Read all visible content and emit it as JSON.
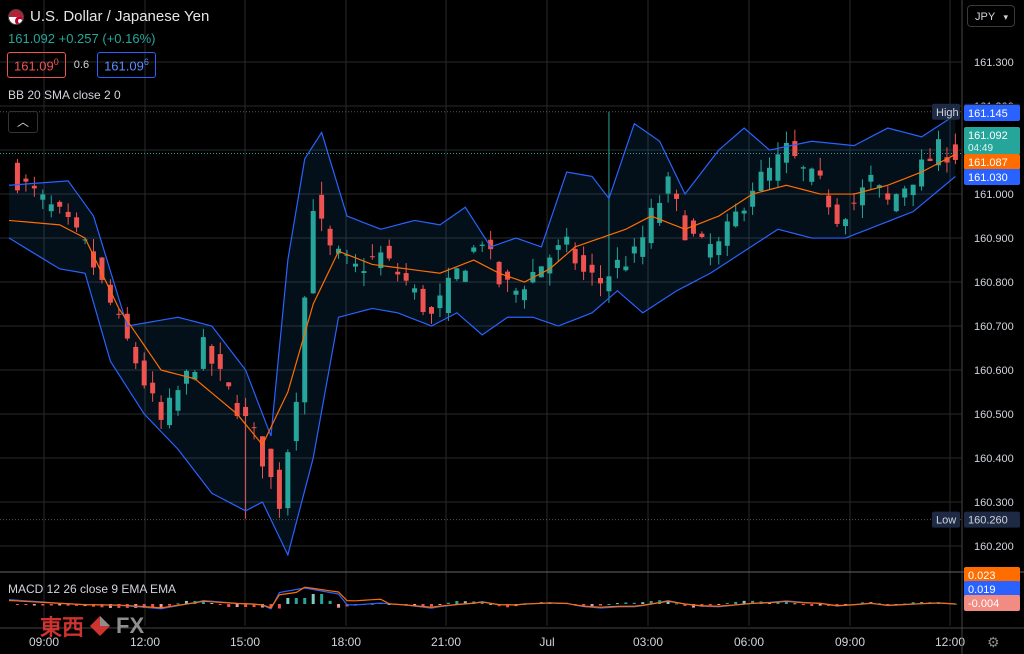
{
  "header": {
    "symbol": "U.S. Dollar / Japanese Yen",
    "last": "161.092",
    "change": "+0.257 (+0.16%)",
    "bid": "161.09",
    "bid_sup": "0",
    "spread": "0.6",
    "ask": "161.09",
    "ask_sup": "6",
    "bb_label": "BB 20 SMA close 2 0",
    "collapse_icon": "chevron-up-icon",
    "currency": "JPY"
  },
  "macd_label": "MACD 12 26 close 9 EMA EMA",
  "logo": {
    "cn": "東西",
    "fx": "FX"
  },
  "colors": {
    "up": "#26a69a",
    "down": "#ef5350",
    "bb": "#2962ff",
    "basis": "#ff6d00",
    "macd": "#2962ff",
    "signal": "#ff6d00",
    "grid": "#2a2a2a"
  },
  "chart_data": {
    "type": "candlestick",
    "title": "U.S. Dollar / Japanese Yen",
    "ylim": [
      160.163,
      161.341
    ],
    "y_ticks": [
      "161.300",
      "161.200",
      "161.100",
      "161.000",
      "160.900",
      "160.800",
      "160.700",
      "160.600",
      "160.500",
      "160.400",
      "160.300",
      "160.200"
    ],
    "x_ticks": [
      "09:00",
      "12:00",
      "15:00",
      "18:00",
      "21:00",
      "Jul",
      "03:00",
      "06:00",
      "09:00",
      "12:00"
    ],
    "grid": true,
    "series": [
      {
        "name": "Price",
        "kind": "candles",
        "close_path": [
          [
            0,
            161.05
          ],
          [
            3,
            161.0
          ],
          [
            6,
            160.95
          ],
          [
            9,
            160.88
          ],
          [
            12,
            160.75
          ],
          [
            15,
            160.62
          ],
          [
            18,
            160.48
          ],
          [
            20,
            160.55
          ],
          [
            23,
            160.65
          ],
          [
            26,
            160.55
          ],
          [
            29,
            160.45
          ],
          [
            32,
            160.3
          ],
          [
            34,
            160.55
          ],
          [
            36,
            160.98
          ],
          [
            38,
            160.87
          ],
          [
            41,
            160.83
          ],
          [
            44,
            160.86
          ],
          [
            47,
            160.8
          ],
          [
            50,
            160.72
          ],
          [
            53,
            160.82
          ],
          [
            56,
            160.9
          ],
          [
            58,
            160.8
          ],
          [
            60,
            160.78
          ],
          [
            62,
            160.82
          ],
          [
            64,
            160.86
          ],
          [
            66,
            160.88
          ],
          [
            68,
            160.82
          ],
          [
            70,
            160.8
          ],
          [
            72,
            160.84
          ],
          [
            74,
            160.86
          ],
          [
            75,
            160.9
          ],
          [
            76,
            160.95
          ],
          [
            78,
            161.02
          ],
          [
            80,
            160.92
          ],
          [
            82,
            160.88
          ],
          [
            84,
            160.88
          ],
          [
            86,
            160.95
          ],
          [
            88,
            161.02
          ],
          [
            90,
            161.05
          ],
          [
            92,
            161.1
          ],
          [
            94,
            161.05
          ],
          [
            96,
            161.02
          ],
          [
            98,
            160.95
          ],
          [
            100,
            160.98
          ],
          [
            102,
            161.03
          ],
          [
            104,
            160.98
          ],
          [
            106,
            161.02
          ],
          [
            108,
            161.06
          ],
          [
            110,
            161.1
          ],
          [
            112,
            161.09
          ]
        ]
      },
      {
        "name": "BB Upper",
        "kind": "line",
        "path": [
          [
            0,
            161.02
          ],
          [
            7,
            161.03
          ],
          [
            10,
            160.95
          ],
          [
            14,
            160.7
          ],
          [
            20,
            160.72
          ],
          [
            24,
            160.7
          ],
          [
            28,
            160.6
          ],
          [
            31,
            160.45
          ],
          [
            33,
            160.85
          ],
          [
            35,
            161.08
          ],
          [
            37,
            161.14
          ],
          [
            40,
            160.95
          ],
          [
            44,
            160.92
          ],
          [
            48,
            160.94
          ],
          [
            51,
            160.93
          ],
          [
            54,
            160.97
          ],
          [
            57,
            160.88
          ],
          [
            60,
            160.9
          ],
          [
            63,
            160.88
          ],
          [
            66,
            161.05
          ],
          [
            69,
            161.04
          ],
          [
            71,
            160.99
          ],
          [
            74,
            161.16
          ],
          [
            77,
            161.12
          ],
          [
            80,
            161.0
          ],
          [
            84,
            161.1
          ],
          [
            87,
            161.15
          ],
          [
            90,
            161.1
          ],
          [
            95,
            161.12
          ],
          [
            100,
            161.11
          ],
          [
            104,
            161.15
          ],
          [
            108,
            161.13
          ],
          [
            112,
            161.18
          ]
        ]
      },
      {
        "name": "BB Lower",
        "kind": "line",
        "path": [
          [
            0,
            160.9
          ],
          [
            6,
            160.83
          ],
          [
            9,
            160.82
          ],
          [
            12,
            160.62
          ],
          [
            16,
            160.5
          ],
          [
            20,
            160.42
          ],
          [
            24,
            160.32
          ],
          [
            28,
            160.28
          ],
          [
            30,
            160.3
          ],
          [
            33,
            160.18
          ],
          [
            36,
            160.4
          ],
          [
            39,
            160.72
          ],
          [
            43,
            160.74
          ],
          [
            46,
            160.73
          ],
          [
            50,
            160.7
          ],
          [
            53,
            160.73
          ],
          [
            56,
            160.68
          ],
          [
            59,
            160.72
          ],
          [
            62,
            160.72
          ],
          [
            65,
            160.7
          ],
          [
            69,
            160.73
          ],
          [
            72,
            160.78
          ],
          [
            75,
            160.73
          ],
          [
            79,
            160.78
          ],
          [
            83,
            160.82
          ],
          [
            87,
            160.87
          ],
          [
            91,
            160.92
          ],
          [
            95,
            160.9
          ],
          [
            99,
            160.9
          ],
          [
            103,
            160.93
          ],
          [
            107,
            160.96
          ],
          [
            112,
            161.04
          ]
        ]
      },
      {
        "name": "BB Basis",
        "kind": "line",
        "path": [
          [
            0,
            160.94
          ],
          [
            6,
            160.93
          ],
          [
            9,
            160.9
          ],
          [
            13,
            160.74
          ],
          [
            18,
            160.6
          ],
          [
            22,
            160.58
          ],
          [
            27,
            160.5
          ],
          [
            30,
            160.43
          ],
          [
            33,
            160.55
          ],
          [
            36,
            160.75
          ],
          [
            39,
            160.87
          ],
          [
            43,
            160.84
          ],
          [
            47,
            160.83
          ],
          [
            51,
            160.82
          ],
          [
            55,
            160.85
          ],
          [
            58,
            160.82
          ],
          [
            61,
            160.8
          ],
          [
            64,
            160.83
          ],
          [
            67,
            160.88
          ],
          [
            70,
            160.9
          ],
          [
            73,
            160.92
          ],
          [
            76,
            160.95
          ],
          [
            80,
            160.92
          ],
          [
            84,
            160.95
          ],
          [
            88,
            161.0
          ],
          [
            92,
            161.02
          ],
          [
            96,
            161.0
          ],
          [
            100,
            161.0
          ],
          [
            104,
            161.02
          ],
          [
            108,
            161.05
          ],
          [
            112,
            161.09
          ]
        ]
      }
    ],
    "annotations": [
      {
        "label": "High",
        "value": "161.187"
      },
      {
        "label": "Low",
        "value": "160.260"
      }
    ],
    "price_labels": [
      {
        "value": "161.145",
        "role": "BB upper"
      },
      {
        "value": "161.092",
        "countdown": "04:49",
        "role": "last price"
      },
      {
        "value": "161.087",
        "role": "BB basis"
      },
      {
        "value": "161.030",
        "role": "BB lower"
      }
    ],
    "macd": {
      "labels": [
        {
          "value": "0.023",
          "role": "signal"
        },
        {
          "value": "0.019",
          "role": "macd"
        },
        {
          "value": "-0.004",
          "role": "histogram"
        }
      ]
    }
  }
}
